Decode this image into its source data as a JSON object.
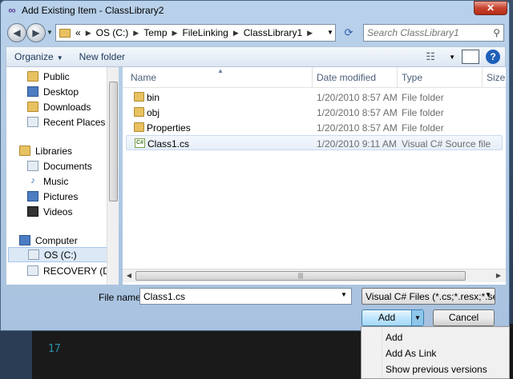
{
  "window": {
    "title": "Add Existing Item - ClassLibrary2",
    "close_glyph": "✕"
  },
  "address": {
    "overflow": "«",
    "crumbs": [
      "OS (C:)",
      "Temp",
      "FileLinking",
      "ClassLibrary1"
    ],
    "search_placeholder": "Search ClassLibrary1"
  },
  "toolbar": {
    "organize_label": "Organize",
    "new_folder_label": "New folder",
    "help_glyph": "?"
  },
  "nav": {
    "items": [
      {
        "label": "Public",
        "icon": "folder-icon"
      },
      {
        "label": "Desktop",
        "icon": "desktop-icon"
      },
      {
        "label": "Downloads",
        "icon": "downloads-icon"
      },
      {
        "label": "Recent Places",
        "icon": "recent-places-icon"
      },
      {
        "label": "Libraries",
        "icon": "libraries-icon"
      },
      {
        "label": "Documents",
        "icon": "documents-icon"
      },
      {
        "label": "Music",
        "icon": "music-icon"
      },
      {
        "label": "Pictures",
        "icon": "pictures-icon"
      },
      {
        "label": "Videos",
        "icon": "videos-icon"
      },
      {
        "label": "Computer",
        "icon": "computer-icon"
      },
      {
        "label": "OS (C:)",
        "icon": "drive-icon"
      },
      {
        "label": "RECOVERY (D:)",
        "icon": "drive-icon"
      }
    ]
  },
  "files": {
    "columns": {
      "name": "Name",
      "date": "Date modified",
      "type": "Type",
      "size": "Size"
    },
    "rows": [
      {
        "name": "bin",
        "date": "1/20/2010 8:57 AM",
        "type": "File folder",
        "icon": "folder-icon"
      },
      {
        "name": "obj",
        "date": "1/20/2010 8:57 AM",
        "type": "File folder",
        "icon": "folder-icon"
      },
      {
        "name": "Properties",
        "date": "1/20/2010 8:57 AM",
        "type": "File folder",
        "icon": "folder-icon"
      },
      {
        "name": "Class1.cs",
        "date": "1/20/2010 9:11 AM",
        "type": "Visual C# Source file",
        "icon": "csharp-file-icon"
      }
    ]
  },
  "bottom": {
    "filename_label": "File name:",
    "filename_value": "Class1.cs",
    "filter_value": "Visual C# Files (*.cs;*.resx;*.setti",
    "add_label": "Add",
    "cancel_label": "Cancel"
  },
  "menu": {
    "items": [
      "Add",
      "Add As Link",
      "Show previous versions"
    ]
  },
  "editor": {
    "line_number": "17"
  }
}
